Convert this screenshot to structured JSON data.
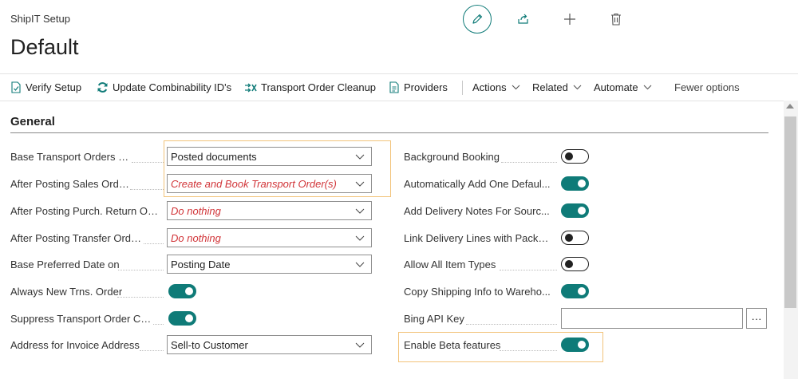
{
  "page": {
    "caption": "ShipIT Setup",
    "title": "Default"
  },
  "icons": {
    "edit": "pencil-icon",
    "share": "share-icon",
    "new": "plus-icon",
    "delete": "trash-icon"
  },
  "actionbar": {
    "verify_setup": "Verify Setup",
    "update_ids": "Update Combinability ID's",
    "cleanup": "Transport Order Cleanup",
    "providers": "Providers",
    "actions": "Actions",
    "related": "Related",
    "automate": "Automate",
    "fewer_options": "Fewer options"
  },
  "section": {
    "title": "General"
  },
  "left_fields": [
    {
      "label": "Base Transport Orders On",
      "value": "Posted documents"
    },
    {
      "label": "After Posting Sales Orders",
      "value": "Create and Book Transport Order(s)"
    },
    {
      "label": "After Posting Purch. Return Or...",
      "value": "Do nothing"
    },
    {
      "label": "After Posting Transfer Orders",
      "value": "Do nothing"
    },
    {
      "label": "Base Preferred Date on",
      "value": "Posting Date"
    },
    {
      "label": "Always New Trns. Order",
      "value": "on"
    },
    {
      "label": "Suppress Transport Order Cre...",
      "value": "on"
    },
    {
      "label": "Address for Invoice Address",
      "value": "Sell-to Customer"
    }
  ],
  "right_fields": [
    {
      "label": "Background Booking",
      "value": "off"
    },
    {
      "label": "Automatically Add One Defaul...",
      "value": "on"
    },
    {
      "label": "Add Delivery Notes For Sourc...",
      "value": "on"
    },
    {
      "label": "Link Delivery Lines with Packa...",
      "value": "off"
    },
    {
      "label": "Allow All Item Types",
      "value": "off"
    },
    {
      "label": "Copy Shipping Info to Wareho...",
      "value": "on"
    },
    {
      "label": "Bing API Key",
      "value": "",
      "button": "···"
    },
    {
      "label": "Enable Beta features",
      "value": "on"
    }
  ],
  "colors": {
    "accent": "#0f7b78",
    "warning_text": "#d13438",
    "highlight": "#f2c37a"
  }
}
